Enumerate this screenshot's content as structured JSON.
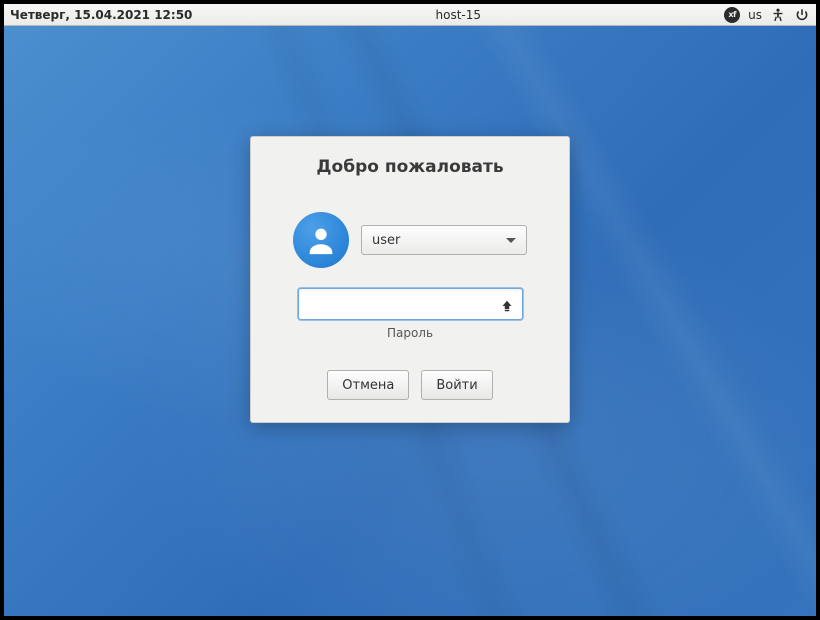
{
  "topbar": {
    "datetime": "Четверг, 15.04.2021 12:50",
    "hostname": "host-15",
    "xf_badge": "xf",
    "lang": "us"
  },
  "login": {
    "title": "Добро пожаловать",
    "selected_user": "user",
    "password_value": "",
    "password_label": "Пароль",
    "cancel_label": "Отмена",
    "submit_label": "Войти"
  }
}
